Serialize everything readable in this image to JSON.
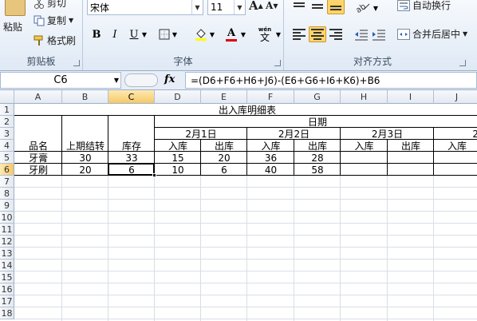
{
  "ribbon": {
    "clipboard": {
      "paste": "粘贴",
      "cut": "剪切",
      "copy": "复制",
      "format_painter": "格式刷",
      "title": "剪贴板"
    },
    "font": {
      "font_name": "宋体",
      "font_size": "11",
      "grow": "A",
      "shrink": "A",
      "bold": "B",
      "italic": "I",
      "underline": "U",
      "phonetic_top": "wén",
      "phonetic_char": "文",
      "title": "字体"
    },
    "alignment": {
      "wrap_text": "自动换行",
      "merge_center": "合并后居中",
      "title": "对齐方式"
    }
  },
  "formula_bar": {
    "name_box": "C6",
    "fx": "fx",
    "formula": "=(D6+F6+H6+J6)-(E6+G6+I6+K6)+B6"
  },
  "columns": [
    "A",
    "B",
    "C",
    "D",
    "E",
    "F",
    "G",
    "H",
    "I",
    "J"
  ],
  "rows": [
    "1",
    "2",
    "3",
    "4",
    "5",
    "6",
    "7",
    "8",
    "9",
    "10",
    "11",
    "12",
    "13",
    "14",
    "15",
    "16",
    "17",
    "18"
  ],
  "sheet": {
    "title": "出入库明细表",
    "date_header": "日期",
    "date1": "2月1日",
    "date2": "2月2日",
    "date3": "2月3日",
    "date4_partial": "2",
    "h_name": "品名",
    "h_prev": "上期结转",
    "h_stock": "库存",
    "h_in": "入库",
    "h_out": "出库",
    "r5": {
      "name": "牙膏",
      "prev": "30",
      "stock": "33",
      "d1_in": "15",
      "d1_out": "20",
      "d2_in": "36",
      "d2_out": "28"
    },
    "r6": {
      "name": "牙刷",
      "prev": "20",
      "stock": "6",
      "d1_in": "10",
      "d1_out": "6",
      "d2_in": "40",
      "d2_out": "58"
    }
  }
}
